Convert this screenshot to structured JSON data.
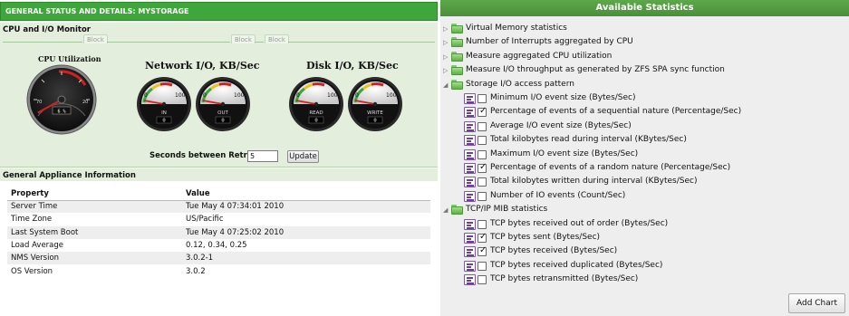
{
  "left_panel": {
    "header": "GENERAL STATUS AND DETAILS: MYSTORAGE",
    "cpu_io": {
      "title": "CPU and I/O Monitor",
      "block_tabs": [
        "Block",
        "Block",
        "Block"
      ],
      "cpu_utilization": {
        "title": "CPU Utilization",
        "ticks": [
          "70",
          "20"
        ],
        "value": "6 %",
        "value_percent": 6
      },
      "network_io": {
        "title": "Network I/O, KB/Sec",
        "gauges": [
          {
            "label": "IN",
            "min": "0",
            "max": "100",
            "value": "0"
          },
          {
            "label": "OUT",
            "min": "0",
            "max": "100",
            "value": "0"
          }
        ]
      },
      "disk_io": {
        "title": "Disk I/O, KB/Sec",
        "gauges": [
          {
            "label": "READ",
            "min": "0",
            "max": "100",
            "value": "0"
          },
          {
            "label": "WRITE",
            "min": "0",
            "max": "100",
            "value": "0"
          }
        ]
      },
      "retrieve": {
        "label": "Seconds between Retrieves",
        "value": "5",
        "button": "Update"
      }
    },
    "appliance_info": {
      "title": "General Appliance Information",
      "columns": [
        "Property",
        "Value"
      ],
      "rows": [
        [
          "Server Time",
          "Tue May 4 07:34:01 2010"
        ],
        [
          "Time Zone",
          "US/Pacific"
        ],
        [
          "Last System Boot",
          "Tue May 4 07:25:02 2010"
        ],
        [
          "Load Average",
          "0.12, 0.34, 0.25"
        ],
        [
          "NMS Version",
          "3.0.2-1"
        ],
        [
          "OS Version",
          "3.0.2"
        ]
      ]
    }
  },
  "right_panel": {
    "header": "Available Statistics",
    "categories_collapsed": [
      "Virtual Memory statistics",
      "Number of Interrupts aggregated by CPU",
      "Measure aggregated CPU utilization",
      "Measure I/O throughput as generated by ZFS SPA sync function"
    ],
    "storage": {
      "label": "Storage I/O access pattern",
      "items": [
        {
          "label": "Minimum I/O event size (Bytes/Sec)",
          "checked": false
        },
        {
          "label": "Percentage of events of a sequential nature (Percentage/Sec)",
          "checked": true
        },
        {
          "label": "Average I/O event size (Bytes/Sec)",
          "checked": false
        },
        {
          "label": "Total kilobytes read during interval (KBytes/Sec)",
          "checked": false
        },
        {
          "label": "Maximum I/O event size (Bytes/Sec)",
          "checked": false
        },
        {
          "label": "Percentage of events of a random nature (Percentage/Sec)",
          "checked": true
        },
        {
          "label": "Total kilobytes written during interval (KBytes/Sec)",
          "checked": false
        },
        {
          "label": "Number of IO events (Count/Sec)",
          "checked": false
        }
      ]
    },
    "tcpip": {
      "label": "TCP/IP MIB statistics",
      "items": [
        {
          "label": "TCP bytes received out of order (Bytes/Sec)",
          "checked": false
        },
        {
          "label": "TCP bytes sent (Bytes/Sec)",
          "checked": true
        },
        {
          "label": "TCP bytes received (Bytes/Sec)",
          "checked": true
        },
        {
          "label": "TCP bytes received duplicated (Bytes/Sec)",
          "checked": false
        },
        {
          "label": "TCP bytes retransmitted (Bytes/Sec)",
          "checked": false
        }
      ]
    },
    "add_chart_button": "Add Chart"
  },
  "colors": {
    "header_green": "#3ea63a",
    "panel_green": "#e3efdc",
    "gauge_red": "#cc2222",
    "gauge_yellow": "#e8c21a",
    "gauge_green": "#3aa53a"
  },
  "icons": [
    "expand-arrow-icon",
    "collapse-arrow-icon",
    "folder-icon",
    "stat-chart-icon",
    "checkbox-icon"
  ]
}
